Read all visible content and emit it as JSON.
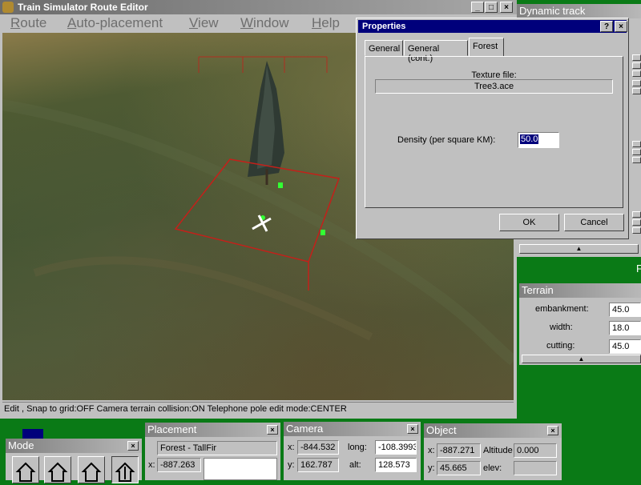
{
  "window": {
    "title": "Train Simulator Route Editor",
    "controls": [
      "_",
      "□",
      "×"
    ]
  },
  "menu": {
    "items": [
      {
        "label": "Route",
        "accel": "R",
        "rest": "oute"
      },
      {
        "label": "Auto-placement",
        "accel": "A",
        "rest": "uto-placement"
      },
      {
        "label": "View",
        "accel": "V",
        "rest": "iew"
      },
      {
        "label": "Window",
        "accel": "W",
        "rest": "indow"
      },
      {
        "label": "Help",
        "accel": "H",
        "rest": "elp"
      }
    ]
  },
  "status_bar": {
    "text": "Edit , Snap to grid:OFF Camera terrain collision:ON Telephone pole edit mode:CENTER"
  },
  "properties_dialog": {
    "title": "Properties",
    "help_glyph": "?",
    "close_glyph": "×",
    "tabs": [
      "General",
      "General (cont.)",
      "Forest"
    ],
    "active_tab": "Forest",
    "texture_label": "Texture file:",
    "texture_value": "Tree3.ace",
    "density_label": "Density (per square KM):",
    "density_value": "50.0",
    "ok_label": "OK",
    "cancel_label": "Cancel"
  },
  "dynamic_track": {
    "title": "Dynamic track"
  },
  "terrain": {
    "title": "Terrain",
    "embankment_label": "embankment:",
    "embankment_value": "45.0",
    "width_label": "width:",
    "width_value": "18.0",
    "cutting_label": "cutting:",
    "cutting_value": "45.0"
  },
  "right_edge": {
    "text1": "F",
    "text2": "F"
  },
  "mode_panel": {
    "title": "Mode",
    "close_glyph": "×"
  },
  "placement_panel": {
    "title": "Placement",
    "close_glyph": "×",
    "object_name": "Forest - TallFir",
    "x_label": "x:",
    "x_value": "-887.263"
  },
  "camera_panel": {
    "title": "Camera",
    "close_glyph": "×",
    "x_label": "x:",
    "x_value": "-844.532",
    "y_label": "y:",
    "y_value": "162.787",
    "long_label": "long:",
    "long_value": "-108.3993",
    "alt_label": "alt:",
    "alt_value": "128.573"
  },
  "object_panel": {
    "title": "Object",
    "close_glyph": "×",
    "x_label": "x:",
    "x_value": "-887.271",
    "y_label": "y:",
    "y_value": "45.665",
    "altitude_label": "Altitude",
    "altitude_value": "0.000",
    "elev_label": "elev:"
  },
  "colors": {
    "desktop": "#0a7a16",
    "dialog_title": "#00007b",
    "selection_red": "#c4201a",
    "marker_green": "#33ff33"
  }
}
